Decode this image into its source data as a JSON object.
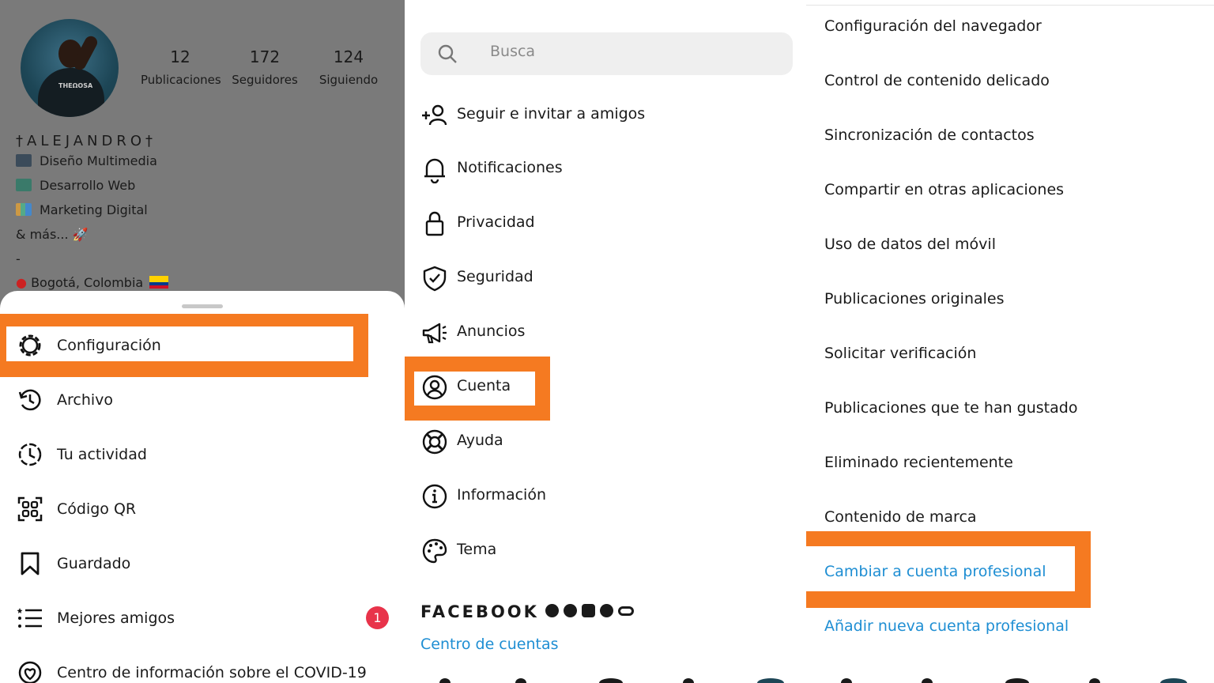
{
  "profile": {
    "stats": [
      {
        "value": "12",
        "label": "Publicaciones"
      },
      {
        "value": "172",
        "label": "Seguidores"
      },
      {
        "value": "124",
        "label": "Siguiendo"
      }
    ],
    "name": "†ALEJANDRO†",
    "bio": [
      "Diseño Multimedia",
      "Desarrollo Web",
      "Marketing Digital",
      "& más... 🚀",
      "-",
      "Bogotá, Colombia"
    ]
  },
  "sheet_menu": {
    "items": [
      {
        "label": "Configuración",
        "icon": "gear-icon"
      },
      {
        "label": "Archivo",
        "icon": "archive-icon"
      },
      {
        "label": "Tu actividad",
        "icon": "activity-icon"
      },
      {
        "label": "Código QR",
        "icon": "qr-icon"
      },
      {
        "label": "Guardado",
        "icon": "bookmark-icon"
      },
      {
        "label": "Mejores amigos",
        "icon": "close-friends-icon"
      },
      {
        "label": "Centro de información sobre el COVID-19",
        "icon": "covid-icon"
      }
    ],
    "badge": "1"
  },
  "settings": {
    "search_placeholder": "Busca",
    "items": [
      {
        "label": "Seguir e invitar a amigos",
        "icon": "add-user-icon"
      },
      {
        "label": "Notificaciones",
        "icon": "bell-icon"
      },
      {
        "label": "Privacidad",
        "icon": "lock-icon"
      },
      {
        "label": "Seguridad",
        "icon": "shield-icon"
      },
      {
        "label": "Anuncios",
        "icon": "megaphone-icon"
      },
      {
        "label": "Cuenta",
        "icon": "account-icon"
      },
      {
        "label": "Ayuda",
        "icon": "help-icon"
      },
      {
        "label": "Información",
        "icon": "info-icon"
      },
      {
        "label": "Tema",
        "icon": "palette-icon"
      }
    ],
    "facebook_label": "FACEBOOK",
    "accounts_center": "Centro de cuentas"
  },
  "account": {
    "items": [
      "Configuración del navegador",
      "Control de contenido delicado",
      "Sincronización de contactos",
      "Compartir en otras aplicaciones",
      "Uso de datos del móvil",
      "Publicaciones originales",
      "Solicitar verificación",
      "Publicaciones que te han gustado",
      "Eliminado recientemente",
      "Contenido de marca"
    ],
    "switch_professional": "Cambiar a cuenta profesional",
    "add_professional": "Añadir nueva cuenta profesional"
  },
  "colors": {
    "highlight": "#f57a21",
    "link": "#1e8ed3",
    "badge": "#e8334a",
    "overlay": "#7a7a7a"
  }
}
